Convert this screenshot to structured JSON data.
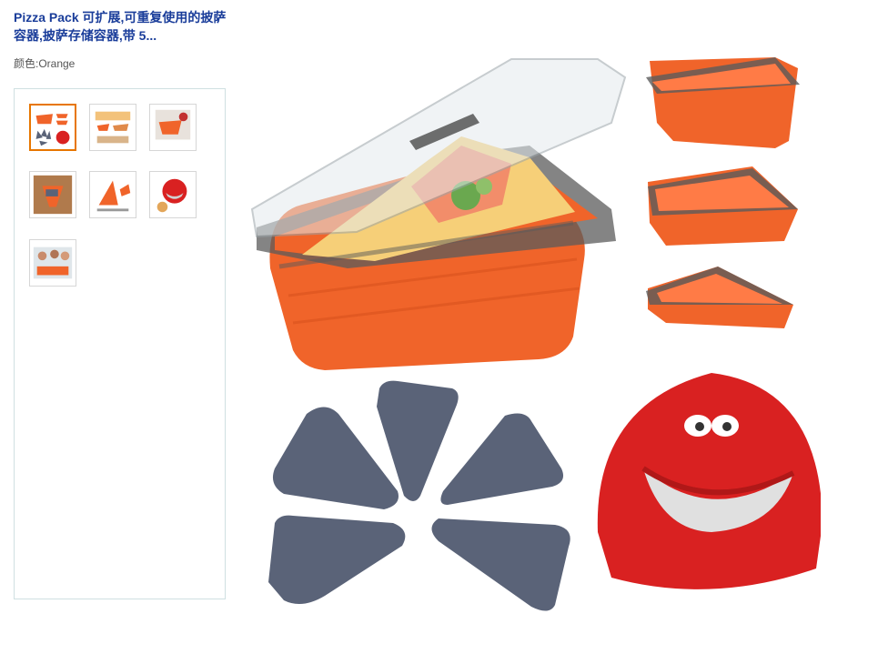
{
  "product": {
    "title": "Pizza Pack 可扩展,可重复使用的披萨容器,披萨存储容器,带 5...",
    "color_label": "颜色:Orange",
    "selected_color": "Orange"
  },
  "thumbnails": [
    {
      "label": "thumbnail-1",
      "selected": true
    },
    {
      "label": "thumbnail-2",
      "selected": false
    },
    {
      "label": "thumbnail-3",
      "selected": false
    },
    {
      "label": "thumbnail-4",
      "selected": false
    },
    {
      "label": "thumbnail-5",
      "selected": false
    },
    {
      "label": "thumbnail-6",
      "selected": false
    },
    {
      "label": "thumbnail-7",
      "selected": false
    }
  ],
  "colors": {
    "title": "#1a3d9a",
    "accent_border": "#e77600",
    "product_orange": "#f0642a",
    "lid_gray": "#5a6378",
    "cutter_red": "#d92121"
  }
}
